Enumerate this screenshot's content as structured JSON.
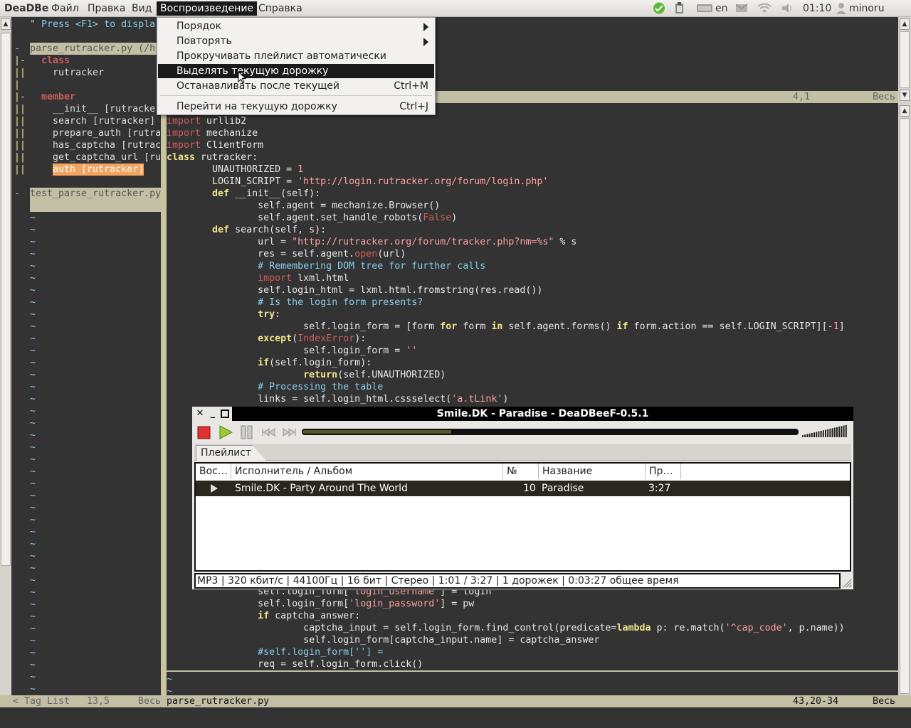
{
  "top_panel": {
    "app_name": "DeaDBe",
    "menus": [
      "Файл",
      "Правка",
      "Вид",
      "Воспроизведение",
      "Справка"
    ],
    "keyboard_layout": "en",
    "clock": "01:10",
    "user": "minoru"
  },
  "playback_menu": {
    "items": [
      {
        "label": "Порядок",
        "accel": "",
        "submenu": true
      },
      {
        "label": "Повторять",
        "accel": "",
        "submenu": true
      },
      {
        "label": "Прокручивать плейлист автоматически",
        "accel": "",
        "submenu": false
      },
      {
        "label": "Выделять текущую дорожку",
        "accel": "",
        "submenu": false,
        "highlighted": true
      },
      {
        "label": "Останавливать после текущей",
        "accel": "Ctrl+M",
        "submenu": false
      },
      {
        "label": "Перейти на текущую дорожку",
        "accel": "Ctrl+J",
        "submenu": false
      }
    ]
  },
  "taglist": {
    "help_line": "\" Press <F1> to displa",
    "file1": "parse_rutracker.py (/h",
    "class_header": "class",
    "class_item": "rutracker",
    "member_header": "member",
    "members": [
      "__init__ [rutracke",
      "search [rutracker]",
      "prepare_auth [rutra",
      "has_captcha [rutrac",
      "get_captcha_url [ru",
      "auth [rutracker]"
    ],
    "file2": "test_parse_rutracker.py",
    "status_name": "< Tag List",
    "status_pos": "13,5",
    "status_pct": "Весь"
  },
  "editor": {
    "upper_status_pos": "4,1",
    "upper_status_pct": "Весь",
    "lines": [
      "import urllib2",
      "import mechanize",
      "import ClientForm",
      "class rutracker:",
      "        UNAUTHORIZED = 1",
      "        LOGIN_SCRIPT = 'http://login.rutracker.org/forum/login.php'",
      "        def __init__(self):",
      "                self.agent = mechanize.Browser()",
      "                self.agent.set_handle_robots(False)",
      "        def search(self, s):",
      "                url = \"http://rutracker.org/forum/tracker.php?nm=%s\" % s",
      "                res = self.agent.open(url)",
      "                # Remembering DOM tree for further calls",
      "                import lxml.html",
      "                self.login_html = lxml.html.fromstring(res.read())",
      "                # Is the login form presents?",
      "                try:",
      "                        self.login_form = [form for form in self.agent.forms() if form.action == self.LOGIN_SCRIPT][-1]",
      "                except(IndexError):",
      "                        self.login_form = ''",
      "                if(self.login_form):",
      "                        return(self.UNAUTHORIZED)",
      "                # Processing the table",
      "                links = self.login_html.cssselect('a.tLink')"
    ],
    "lower_lines": [
      "                self.login_form['login_username'] = login",
      "                self.login_form['login_password'] = pw",
      "                if captcha_answer:",
      "                        captcha_input = self.login_form.find_control(predicate=lambda p: re.match('^cap_code', p.name))",
      "                        self.login_form[captcha_input.name] = captcha_answer",
      "                #self.login_form[''] =",
      "                req = self.login_form.click()"
    ],
    "file_name": "parse_rutracker.py",
    "status_pos": "43,20-34",
    "status_pct": "Весь"
  },
  "player": {
    "title": "Smile.DK - Paradise - DeaDBeeF-0.5.1",
    "progress_fraction": 0.3,
    "volume_fraction": 1.0,
    "tab": "Плейлист",
    "columns": [
      "Вос…",
      "Исполнитель / Альбом",
      "№",
      "Название",
      "Пр…"
    ],
    "rows": [
      {
        "artist_album": "Smile.DK - Party Around The World",
        "track_no": "10",
        "title": "Paradise",
        "duration": "3:27"
      }
    ],
    "status": "MP3 |  320 кбит/с | 44100Гц | 16 бит | Стерео | 1:01 / 3:27 | 1 дорожек | 0:03:27 общее время"
  }
}
